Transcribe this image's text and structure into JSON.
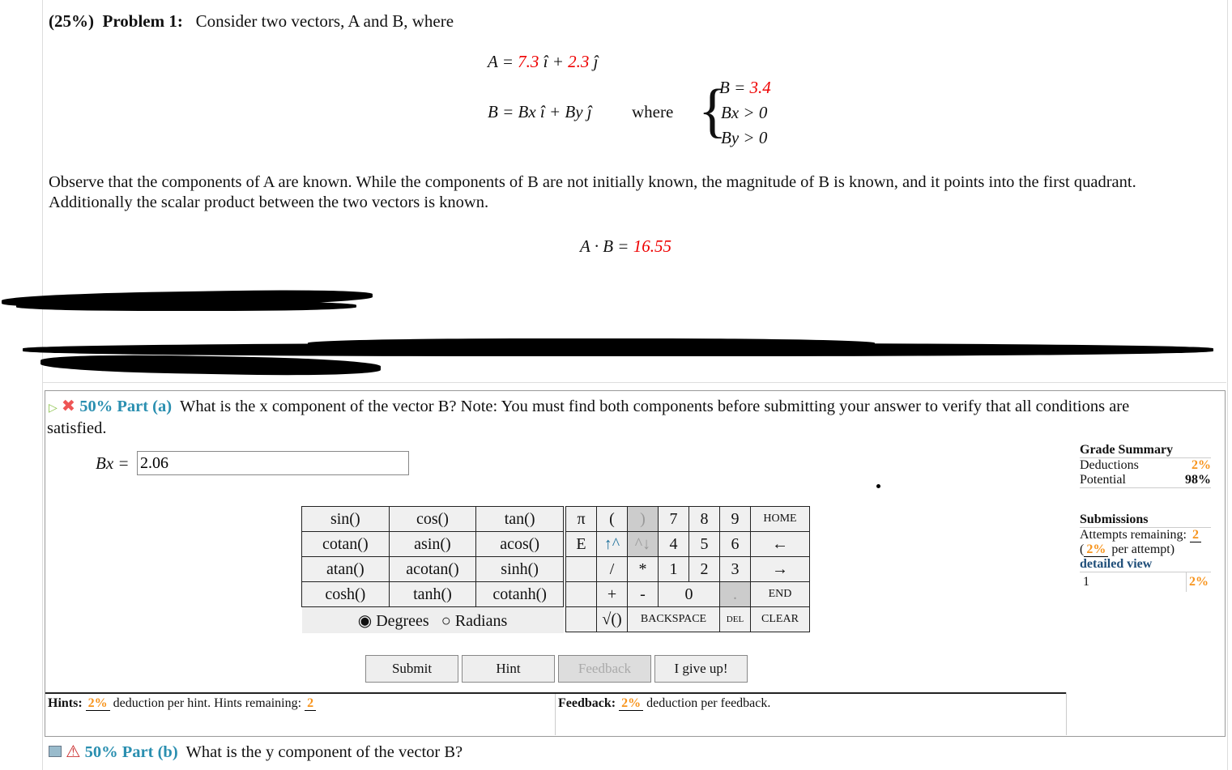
{
  "problem": {
    "weight": "(25%)",
    "label": "Problem 1:",
    "intro": "Consider two vectors, A and B, where",
    "eqA": {
      "lhs": "A =",
      "ax": "7.3",
      "i": "î +",
      "ay": "2.3",
      "j": "ĵ"
    },
    "eqB": {
      "lhs": "B = Bx î + By ĵ",
      "where": "where",
      "c1": "B =",
      "c1v": "3.4",
      "c2": "Bx > 0",
      "c3": "By > 0"
    },
    "para1": "Observe that the components of A are known. While the components of B are not initially known, the magnitude of B is known, and it points into the first quadrant.",
    "para2": "Additionally the scalar product between the two vectors is known.",
    "dot": {
      "lhs": "A · B =",
      "value": "16.55"
    }
  },
  "part_a": {
    "weight": "50% Part (a)",
    "question": "What is the x component of the vector B? Note: You must find both components before submitting your answer to verify that all conditions are",
    "question2": "satisfied.",
    "label": "Bx =",
    "value": "2.06"
  },
  "keypad": {
    "funcs": [
      [
        "sin()",
        "cos()",
        "tan()"
      ],
      [
        "cotan()",
        "asin()",
        "acos()"
      ],
      [
        "atan()",
        "acotan()",
        "sinh()"
      ],
      [
        "cosh()",
        "tanh()",
        "cotanh()"
      ]
    ],
    "degrees": "Degrees",
    "radians": "Radians",
    "keys": {
      "pi": "π",
      "lp": "(",
      "rp": ")",
      "k7": "7",
      "k8": "8",
      "k9": "9",
      "home": "HOME",
      "e": "E",
      "up": "↑^",
      "down": "^↓",
      "k4": "4",
      "k5": "5",
      "k6": "6",
      "left": "←",
      "div": "/",
      "mul": "*",
      "k1": "1",
      "k2": "2",
      "k3": "3",
      "right": "→",
      "plus": "+",
      "minus": "-",
      "k0": "0",
      "dot": ".",
      "end": "END",
      "sqrt": "√()",
      "back": "BACKSPACE",
      "del": "DEL",
      "clear": "CLEAR"
    }
  },
  "buttons": {
    "submit": "Submit",
    "hint": "Hint",
    "feedback": "Feedback",
    "giveup": "I give up!"
  },
  "hints": {
    "label": "Hints:",
    "pct": "2%",
    "text": "deduction per hint. Hints remaining:",
    "remaining": "2"
  },
  "feedback": {
    "label": "Feedback:",
    "pct": "2%",
    "text": "deduction per feedback."
  },
  "grade": {
    "title": "Grade Summary",
    "deductions": "Deductions",
    "deductions_v": "2%",
    "potential": "Potential",
    "potential_v": "98%",
    "sub_title": "Submissions",
    "attempts": "Attempts remaining:",
    "attempts_v": "2",
    "per_pct": "2%",
    "per_text": "per attempt)",
    "detailed": "detailed view",
    "row_n": "1",
    "row_v": "2%"
  },
  "part_b": {
    "weight": "50% Part (b)",
    "question": "What is the y component of the vector B?"
  },
  "colors": {
    "given": "#ee0000",
    "part": "#2a8fb0",
    "orange": "#f7941d"
  }
}
